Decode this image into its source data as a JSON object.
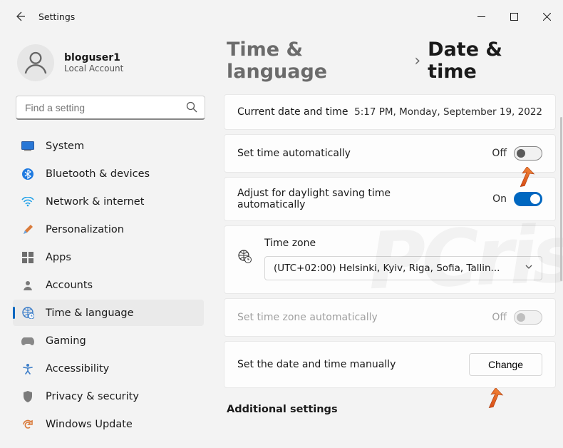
{
  "window": {
    "title": "Settings"
  },
  "user": {
    "name": "bloguser1",
    "account_type": "Local Account"
  },
  "search": {
    "placeholder": "Find a setting"
  },
  "sidebar": {
    "items": [
      {
        "label": "System"
      },
      {
        "label": "Bluetooth & devices"
      },
      {
        "label": "Network & internet"
      },
      {
        "label": "Personalization"
      },
      {
        "label": "Apps"
      },
      {
        "label": "Accounts"
      },
      {
        "label": "Time & language"
      },
      {
        "label": "Gaming"
      },
      {
        "label": "Accessibility"
      },
      {
        "label": "Privacy & security"
      },
      {
        "label": "Windows Update"
      }
    ],
    "active_index": 6
  },
  "breadcrumb": {
    "parent": "Time & language",
    "sep": "›",
    "current": "Date & time"
  },
  "settings": {
    "current_time": {
      "label": "Current date and time",
      "value": "5:17 PM, Monday, September 19, 2022"
    },
    "set_auto": {
      "label": "Set time automatically",
      "state_text": "Off",
      "on": false
    },
    "dst_auto": {
      "label": "Adjust for daylight saving time automatically",
      "state_text": "On",
      "on": true
    },
    "timezone": {
      "label": "Time zone",
      "selected": "(UTC+02:00) Helsinki, Kyiv, Riga, Sofia, Tallin..."
    },
    "tz_auto": {
      "label": "Set time zone automatically",
      "state_text": "Off",
      "on": false
    },
    "manual": {
      "label": "Set the date and time manually",
      "button": "Change"
    },
    "additional": "Additional settings"
  }
}
